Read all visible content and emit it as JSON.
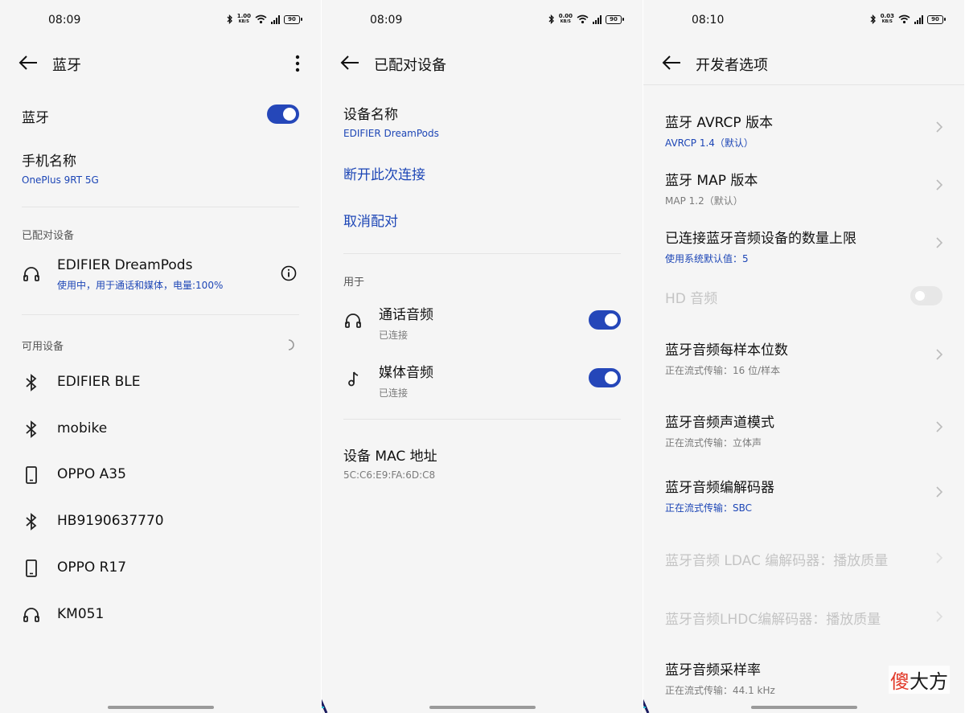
{
  "status_bars": [
    {
      "time": "08:09",
      "speed_top": "1.00",
      "speed_unit": "KB/S",
      "battery": "90"
    },
    {
      "time": "08:09",
      "speed_top": "0.00",
      "speed_unit": "KB/S",
      "battery": "90"
    },
    {
      "time": "08:10",
      "speed_top": "0.03",
      "speed_unit": "KB/S",
      "battery": "90"
    }
  ],
  "screen1": {
    "title": "蓝牙",
    "bluetooth_label": "蓝牙",
    "bluetooth_on": true,
    "phone_name_label": "手机名称",
    "phone_name_value": "OnePlus 9RT 5G",
    "paired_section": "已配对设备",
    "paired_device": {
      "name": "EDIFIER DreamPods",
      "status": "使用中，用于通话和媒体，电量:100%",
      "icon": "headphones-icon"
    },
    "available_section": "可用设备",
    "available_devices": [
      {
        "name": "EDIFIER BLE",
        "icon": "bluetooth-icon"
      },
      {
        "name": "mobike",
        "icon": "bluetooth-icon"
      },
      {
        "name": "OPPO A35",
        "icon": "phone-icon"
      },
      {
        "name": "HB9190637770",
        "icon": "bluetooth-icon"
      },
      {
        "name": "OPPO R17",
        "icon": "phone-icon"
      },
      {
        "name": "KM051",
        "icon": "headphones-icon"
      }
    ]
  },
  "screen2": {
    "title": "已配对设备",
    "device_name_label": "设备名称",
    "device_name_value": "EDIFIER DreamPods",
    "disconnect": "断开此次连接",
    "unpair": "取消配对",
    "used_for_section": "用于",
    "profiles": [
      {
        "name": "通话音频",
        "status": "已连接",
        "on": true,
        "icon": "headphones-icon"
      },
      {
        "name": "媒体音频",
        "status": "已连接",
        "on": true,
        "icon": "music-note-icon"
      }
    ],
    "mac_label": "设备 MAC 地址",
    "mac_value": "5C:C6:E9:FA:6D:C8"
  },
  "screen3": {
    "title": "开发者选项",
    "items": [
      {
        "title": "蓝牙 AVRCP 版本",
        "sub": "AVRCP 1.4（默认）",
        "sub_style": "blue"
      },
      {
        "title": "蓝牙 MAP 版本",
        "sub": "MAP 1.2（默认）",
        "sub_style": "gray"
      },
      {
        "title": "已连接蓝牙音频设备的数量上限",
        "sub": "使用系统默认值：5",
        "sub_style": "blue"
      },
      {
        "title": "HD 音频",
        "disabled": true,
        "toggle_on": false
      },
      {
        "title": "蓝牙音频每样本位数",
        "sub": "正在流式传输：16 位/样本",
        "sub_style": "gray"
      },
      {
        "title": "蓝牙音频声道模式",
        "sub": "正在流式传输：立体声",
        "sub_style": "gray"
      },
      {
        "title": "蓝牙音频编解码器",
        "sub": "正在流式传输：SBC",
        "sub_style": "blue"
      },
      {
        "title": "蓝牙音频 LDAC 编解码器：播放质量",
        "disabled": true
      },
      {
        "title": "蓝牙音频LHDC编解码器：播放质量",
        "disabled": true
      },
      {
        "title": "蓝牙音频采样率",
        "sub": "正在流式传输：44.1 kHz",
        "sub_style": "gray"
      }
    ]
  },
  "watermark": {
    "red": "傻",
    "black": "大方"
  },
  "colors": {
    "accent": "#2547b9",
    "link": "#1d46b6",
    "background": "#f5f5f5"
  }
}
